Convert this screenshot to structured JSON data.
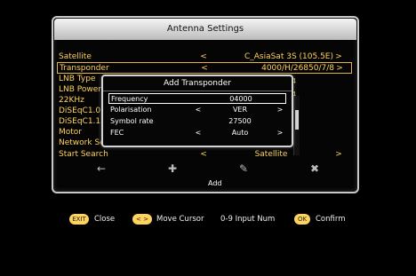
{
  "window": {
    "title": "Antenna Settings"
  },
  "settings": {
    "rows": [
      {
        "label": "Satellite",
        "value": "C_AsiaSat 3S (105.5E)"
      },
      {
        "label": "Transponder",
        "value": "4000/H/26850/7/8"
      },
      {
        "label": "LNB Type",
        "value": ""
      },
      {
        "label": "LNB Power",
        "value": ""
      },
      {
        "label": "22KHz",
        "value": ""
      },
      {
        "label": "DiSEqC1.0",
        "value": ""
      },
      {
        "label": "DiSEqC1.1",
        "value": ""
      },
      {
        "label": "Motor",
        "value": ""
      },
      {
        "label": "Network Search",
        "value": ""
      },
      {
        "label": "Start Search",
        "value": "Satellite"
      }
    ],
    "behind_fragments": [
      "4",
      "4",
      "/8",
      "/2",
      "4"
    ]
  },
  "dialog": {
    "title": "Add Transponder",
    "rows": [
      {
        "label": "Frequency",
        "value": "04000"
      },
      {
        "label": "Polarisation",
        "value": "VER"
      },
      {
        "label": "Symbol rate",
        "value": "27500"
      },
      {
        "label": "FEC",
        "value": "Auto"
      }
    ]
  },
  "icons": {
    "add_label": "Add"
  },
  "footer": {
    "exit_badge": "EXIT",
    "close": "Close",
    "move_cursor": "Move Cursor",
    "input_num": "0-9  Input Num",
    "ok_badge": "OK",
    "confirm": "Confirm"
  },
  "colors": {
    "accent": "#ffd25a",
    "panel_border": "#c9c9c9",
    "title_bg": "#dcdcdc"
  }
}
